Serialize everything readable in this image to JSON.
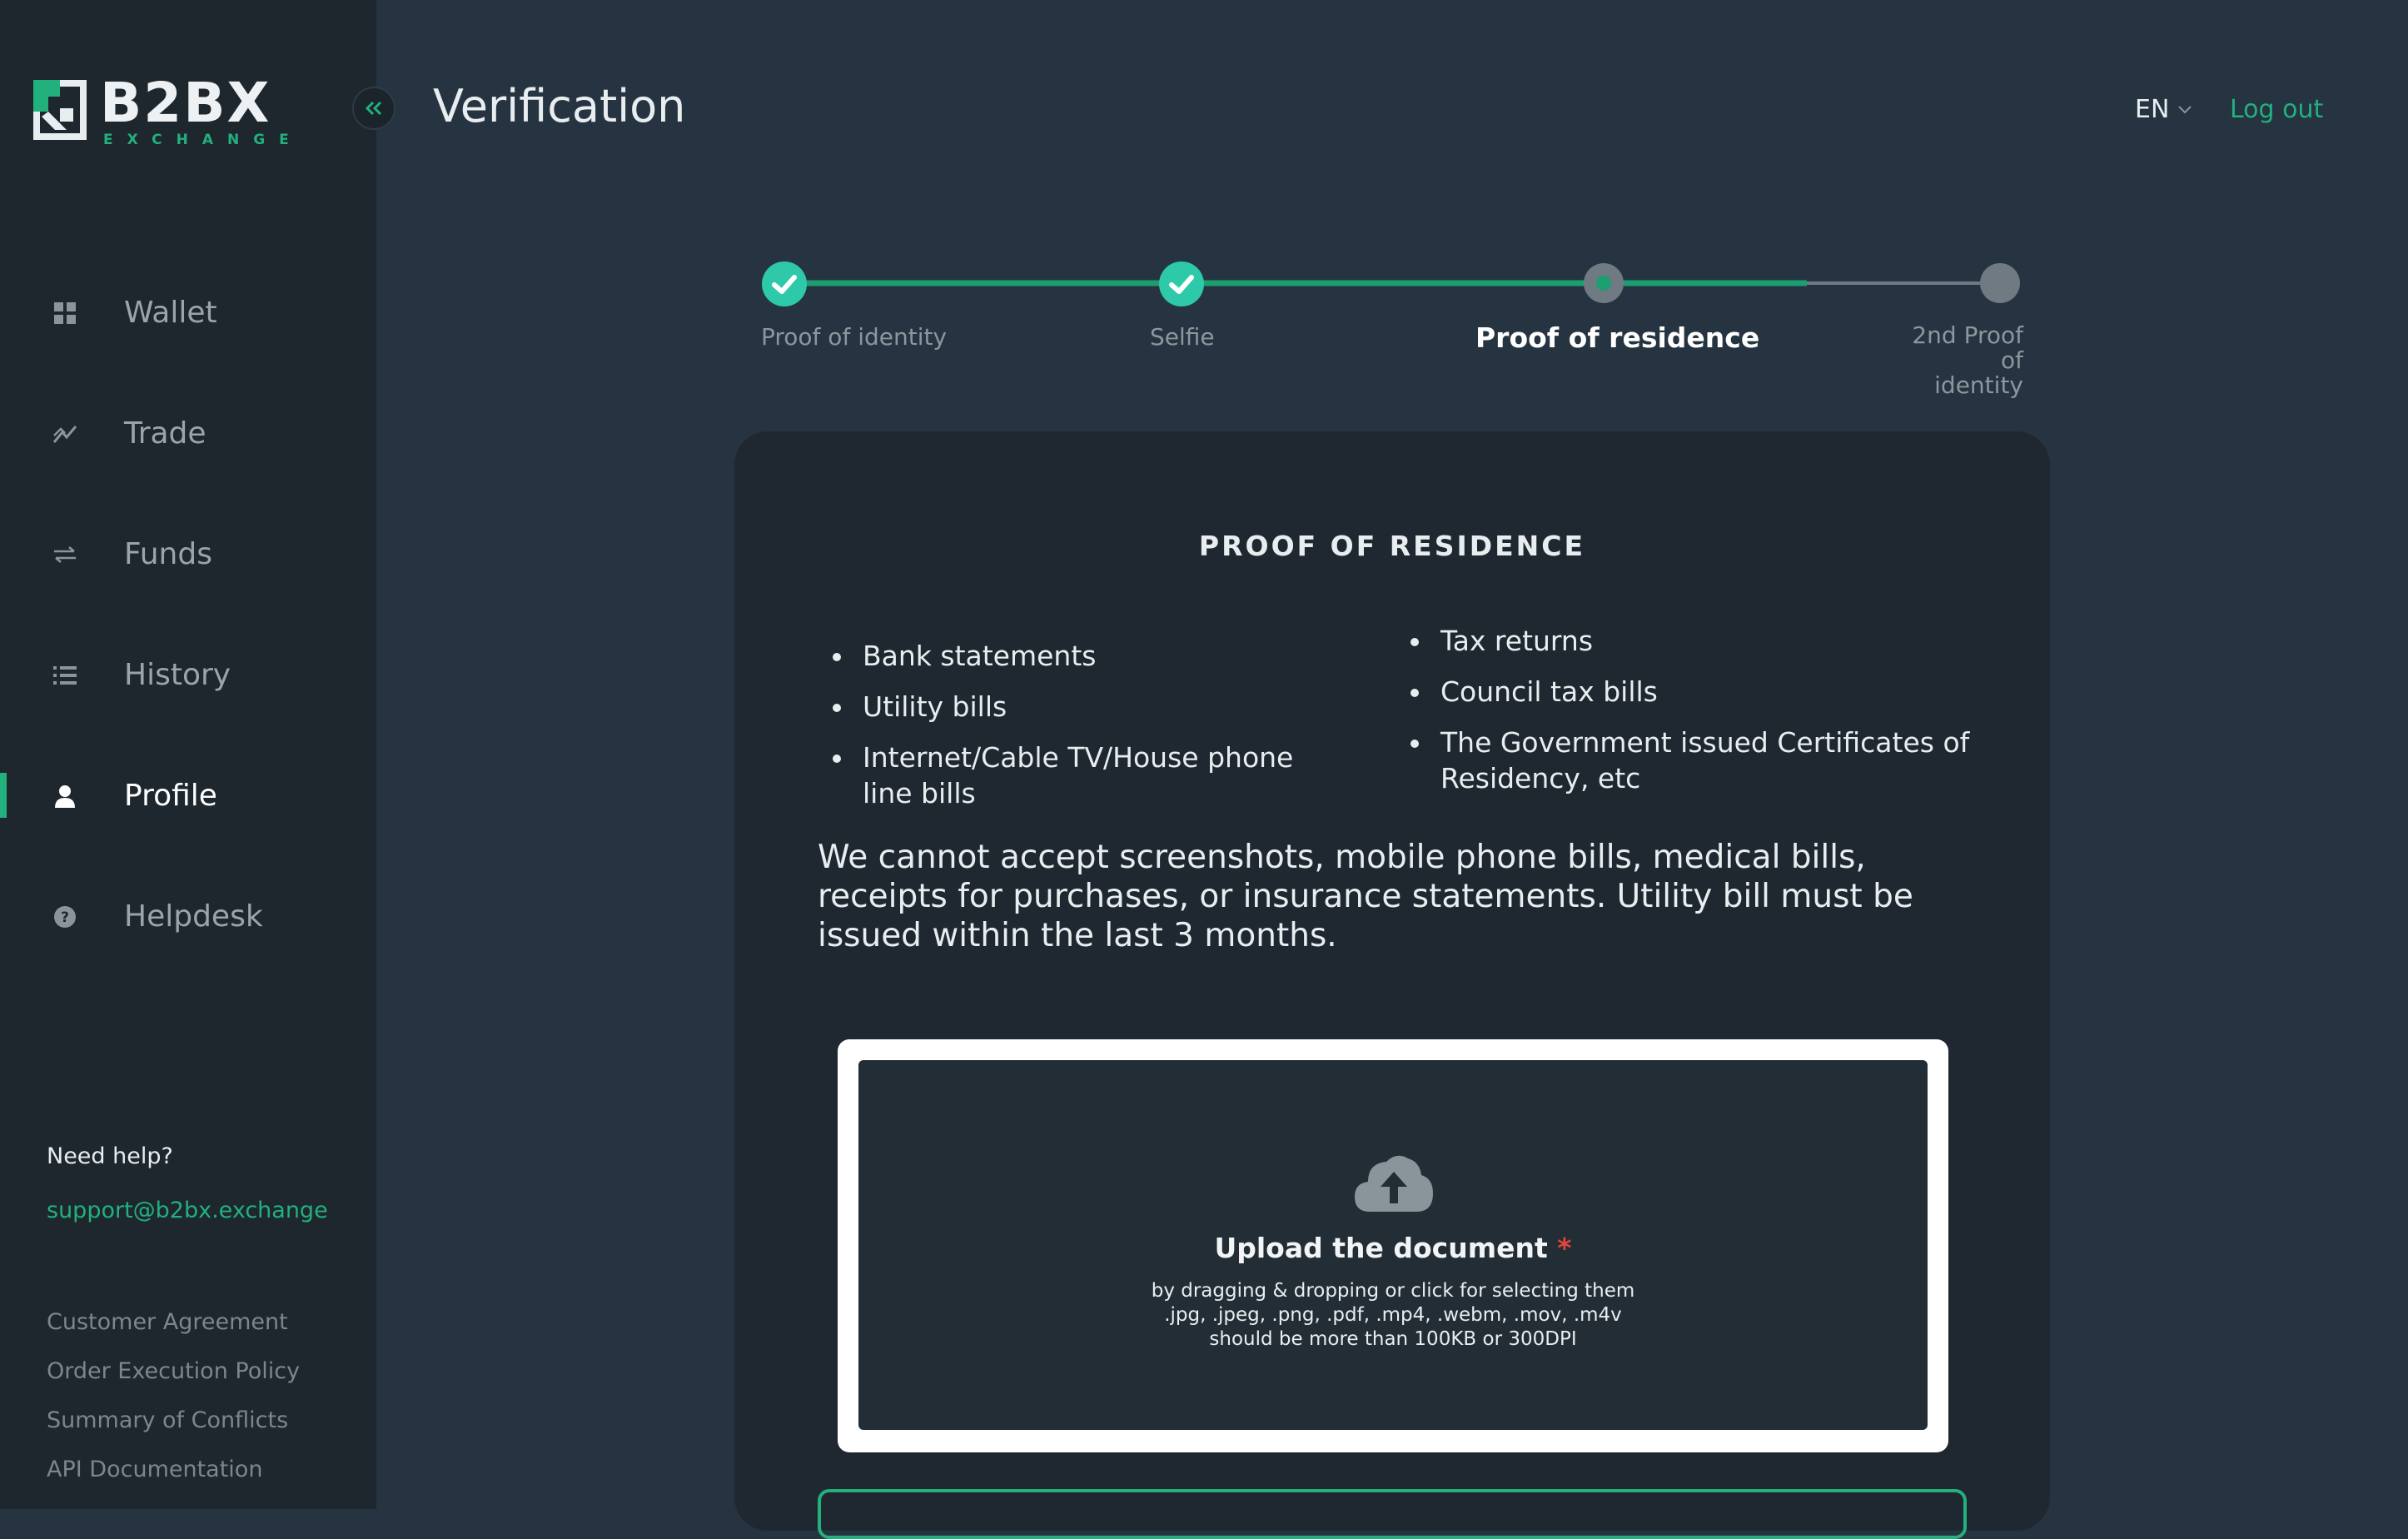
{
  "brand": {
    "name": "B2BX",
    "sub": "EXCHANGE",
    "accent": "#22b07d"
  },
  "sidebar": {
    "items": [
      {
        "label": "Wallet",
        "icon": "grid-icon"
      },
      {
        "label": "Trade",
        "icon": "chart-icon"
      },
      {
        "label": "Funds",
        "icon": "transfer-icon"
      },
      {
        "label": "History",
        "icon": "list-icon"
      },
      {
        "label": "Profile",
        "icon": "user-icon",
        "active": true
      },
      {
        "label": "Helpdesk",
        "icon": "help-icon"
      }
    ],
    "help_title": "Need help?",
    "help_email": "support@b2bx.exchange",
    "links": [
      "Customer Agreement",
      "Order Execution Policy",
      "Summary of Conflicts",
      "API Documentation"
    ]
  },
  "header": {
    "title": "Verification",
    "language": "EN",
    "logout": "Log out"
  },
  "stepper": {
    "steps": [
      {
        "label": "Proof of identity",
        "state": "done"
      },
      {
        "label": "Selfie",
        "state": "done"
      },
      {
        "label": "Proof of residence",
        "state": "current"
      },
      {
        "label_line1": "2nd Proof of",
        "label_line2": "identity",
        "state": "pending"
      }
    ]
  },
  "card": {
    "title": "PROOF OF RESIDENCE",
    "left_list": [
      "Bank statements",
      "Utility bills",
      "Internet/Cable TV/House phone line bills"
    ],
    "right_list": [
      "Tax returns",
      "Council tax bills",
      "The Government issued Certificates of Residency, etc"
    ],
    "notice": "We cannot accept screenshots, mobile phone bills, medical bills, receipts for purchases, or insurance statements. Utility bill must be issued within the last 3 months.",
    "upload": {
      "title": "Upload the document",
      "required_mark": "*",
      "line1": "by dragging & dropping or click for selecting them",
      "line2": ".jpg, .jpeg, .png, .pdf, .mp4, .webm, .mov, .m4v",
      "line3": "should be more than 100KB or 300DPI",
      "icon": "cloud-upload-icon"
    }
  }
}
